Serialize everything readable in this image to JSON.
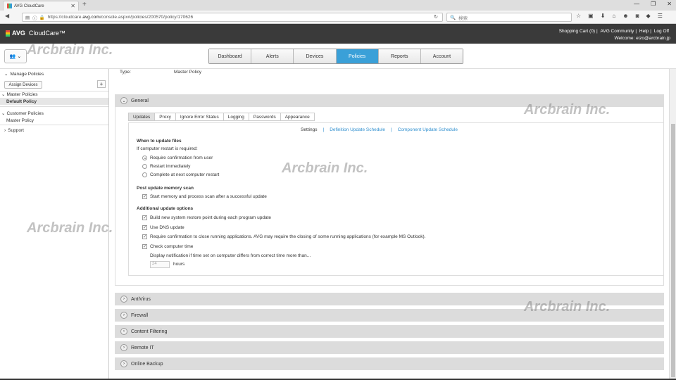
{
  "browser": {
    "tab_title": "AVG CloudCare",
    "url_prefix": "https://cloudcare.",
    "url_domain": "avg.com",
    "url_suffix": "/console.aspx#/policies/200570/policy/170626",
    "search_placeholder": "検索"
  },
  "header": {
    "logo_avg": "AVG",
    "logo_product": "CloudCare™",
    "links": [
      "Shopping Cart (0)",
      "AVG Community",
      "Help",
      "Log Off"
    ],
    "welcome": "Welcome: eizo@arcbrain.jp"
  },
  "nav": {
    "items": [
      "Dashboard",
      "Alerts",
      "Devices",
      "Policies",
      "Reports",
      "Account"
    ],
    "active": "Policies"
  },
  "sidebar": {
    "manage": "Manage Policies",
    "assign": "Assign Devices",
    "plus": "+",
    "master_group": "Master Policies",
    "default_policy": "Default Policy",
    "customer_group": "Customer Policies",
    "master_policy": "Master Policy",
    "support": "Support"
  },
  "content": {
    "type_label": "Type:",
    "type_value": "Master Policy",
    "general": "General",
    "subtabs": [
      "Updates",
      "Proxy",
      "Ignore Error Status",
      "Logging",
      "Passwords",
      "Appearance"
    ],
    "links": [
      "Settings",
      "|",
      "Definition Update Schedule",
      "|",
      "Component Update Schedule"
    ],
    "when_heading": "When to update files",
    "restart_q": "If computer restart is required:",
    "radios": [
      "Require confirmation from user",
      "Restart immediately",
      "Complete at next computer restart"
    ],
    "post_heading": "Post update memory scan",
    "post_opt": "Start memory and process scan after a successful update",
    "additional_heading": "Additional update options",
    "additional_opts": [
      "Build new system restore point during each program update",
      "Use DNS update",
      "Require confirmation to close running applications. AVG may require the closing of some running applications (for example MS Outlook).",
      "Check computer time"
    ],
    "notify_text": "Display notification if time set on computer differs from correct time more than...",
    "hours_value": "24",
    "hours_label": "hours",
    "sections": [
      "AntiVirus",
      "Firewall",
      "Content Filtering",
      "Remote IT",
      "Online Backup"
    ]
  },
  "watermark": "Arcbrain Inc.",
  "check_mark": "✓"
}
